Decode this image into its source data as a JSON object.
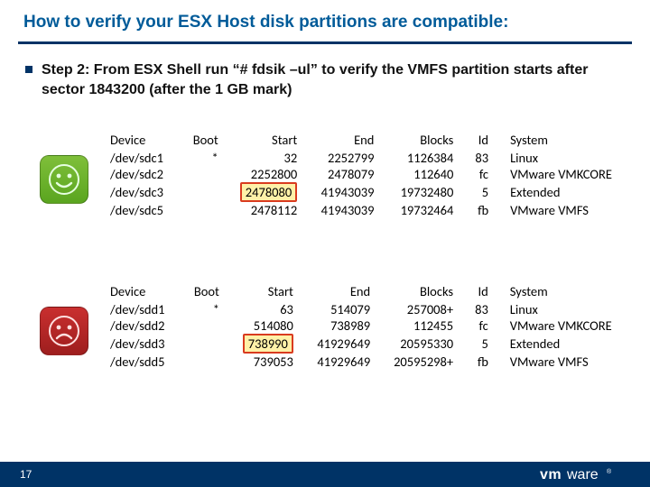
{
  "title": "How to verify your ESX Host disk partitions are compatible:",
  "step": {
    "label": "Step 2:  From ESX Shell run “# fdsik –ul” to verify the VMFS partition starts after sector 1843200 (after the 1 GB mark)"
  },
  "columns": [
    "Device",
    "Boot",
    "Start",
    "End",
    "Blocks",
    "Id",
    "System"
  ],
  "good": {
    "rows": [
      {
        "device": "/dev/sdc1",
        "boot": "*",
        "start": "32",
        "end": "2252799",
        "blocks": "1126384",
        "id": "83",
        "system": "Linux"
      },
      {
        "device": "/dev/sdc2",
        "boot": "",
        "start": "2252800",
        "end": "2478079",
        "blocks": "112640",
        "id": "fc",
        "system": "VMware VMKCORE"
      },
      {
        "device": "/dev/sdc3",
        "boot": "",
        "start": "2478080",
        "end": "41943039",
        "blocks": "19732480",
        "id": "5",
        "system": "Extended",
        "highlight": true
      },
      {
        "device": "/dev/sdc5",
        "boot": "",
        "start": "2478112",
        "end": "41943039",
        "blocks": "19732464",
        "id": "fb",
        "system": "VMware VMFS"
      }
    ]
  },
  "bad": {
    "rows": [
      {
        "device": "/dev/sdd1",
        "boot": "*",
        "start": "63",
        "end": "514079",
        "blocks": "257008+",
        "id": "83",
        "system": "Linux"
      },
      {
        "device": "/dev/sdd2",
        "boot": "",
        "start": "514080",
        "end": "738989",
        "blocks": "112455",
        "id": "fc",
        "system": "VMware VMKCORE"
      },
      {
        "device": "/dev/sdd3",
        "boot": "",
        "start": "738990",
        "end": "41929649",
        "blocks": "20595330",
        "id": "5",
        "system": "Extended",
        "highlight": true
      },
      {
        "device": "/dev/sdd5",
        "boot": "",
        "start": "739053",
        "end": "41929649",
        "blocks": "20595298+",
        "id": "fb",
        "system": "VMware VMFS"
      }
    ]
  },
  "page": "17",
  "logo_text": "vmware",
  "icons": {
    "good": "smile-face-icon",
    "bad": "frown-face-icon"
  }
}
